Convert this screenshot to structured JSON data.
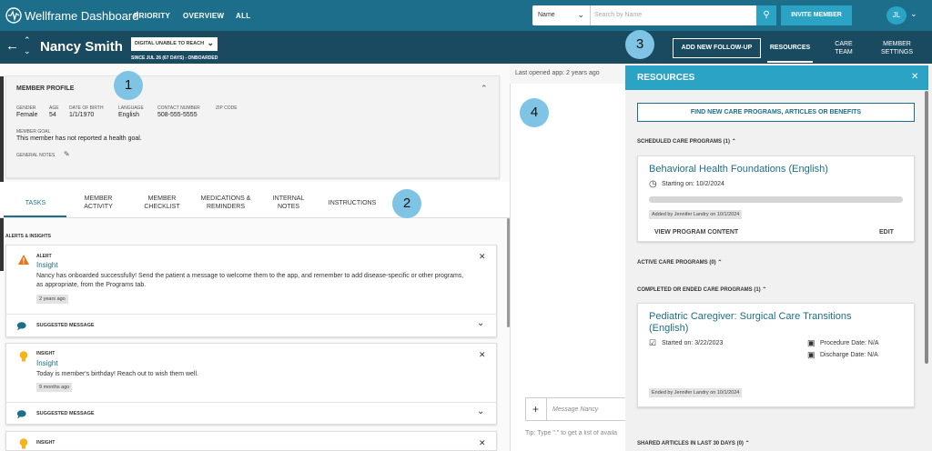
{
  "brand": {
    "title": "Wellframe Dashboard"
  },
  "nav": {
    "items": [
      "PRIORITY",
      "OVERVIEW",
      "ALL"
    ]
  },
  "search": {
    "type": "Name",
    "placeholder": "Search by Name"
  },
  "invite_label": "INVITE MEMBER",
  "user_initials": "JL",
  "patient": {
    "name": "Nancy Smith",
    "status": "DIGITAL UNABLE TO REACH",
    "since": "SINCE JUL 26 (67 DAYS) - ONBOARDED"
  },
  "header_actions": {
    "follow_up": "ADD NEW FOLLOW-UP",
    "tabs": [
      "RESOURCES",
      "CARE TEAM",
      "MEMBER SETTINGS"
    ]
  },
  "callouts": [
    "1",
    "2",
    "3",
    "4"
  ],
  "profile": {
    "title": "MEMBER PROFILE",
    "fields": [
      {
        "label": "GENDER",
        "value": "Female"
      },
      {
        "label": "AGE",
        "value": "54"
      },
      {
        "label": "DATE OF BIRTH",
        "value": "1/1/1970"
      },
      {
        "label": "LANGUAGE",
        "value": "English"
      },
      {
        "label": "CONTACT NUMBER",
        "value": "508-555-5555"
      },
      {
        "label": "ZIP CODE",
        "value": ""
      }
    ],
    "goal_label": "MEMBER GOAL",
    "goal": "This member has not reported a health goal.",
    "notes_label": "GENERAL NOTES"
  },
  "tabs": [
    "TASKS",
    "MEMBER ACTIVITY",
    "MEMBER CHECKLIST",
    "MEDICATIONS & REMINDERS",
    "INTERNAL NOTES",
    "INSTRUCTIONS"
  ],
  "alerts_title": "ALERTS & INSIGHTS",
  "cards": [
    {
      "kind": "ALERT",
      "title": "Insight",
      "body": "Nancy has onboarded successfully! Send the patient a message to welcome them to the app, and remember to add disease-specific or other programs, as appropriate, from the Programs tab.",
      "age": "2 years ago",
      "suggested": "SUGGESTED MESSAGE"
    },
    {
      "kind": "INSIGHT",
      "title": "Insight",
      "body": "Today is member's birthday! Reach out to wish them well.",
      "age": "9 months ago",
      "suggested": "SUGGESTED MESSAGE"
    },
    {
      "kind": "INSIGHT"
    }
  ],
  "chat": {
    "last_opened": "Last opened app: 2 years ago",
    "placeholder": "Message Nancy",
    "tip": "Tip: Type \".\" to get a list of availa"
  },
  "resources": {
    "title": "RESOURCES",
    "find_button": "FIND NEW CARE PROGRAMS, ARTICLES OR BENEFITS",
    "scheduled_header": "SCHEDULED CARE PROGRAMS (1)",
    "scheduled": {
      "title": "Behavioral Health Foundations (English)",
      "start": "Starting on: 10/2/2024",
      "added": "Added by Jennifer Landry on 10/1/2024",
      "view": "VIEW PROGRAM CONTENT",
      "edit": "EDIT"
    },
    "active_header": "ACTIVE CARE PROGRAMS (0)",
    "completed_header": "COMPLETED OR ENDED CARE PROGRAMS (1)",
    "completed": {
      "title": "Pediatric Caregiver: Surgical Care Transitions (English)",
      "started": "Started on: 3/22/2023",
      "procedure": "Procedure Date: N/A",
      "discharge": "Discharge Date: N/A",
      "ended": "Ended by Jennifer Landry on 10/1/2024"
    },
    "shared_header": "SHARED ARTICLES IN LAST 30 DAYS (0)"
  },
  "colors": {
    "top_nav": "#1d6e8a",
    "header": "#1a4a5f",
    "accent": "#2aa3c4",
    "callout": "#7fc4e4"
  }
}
